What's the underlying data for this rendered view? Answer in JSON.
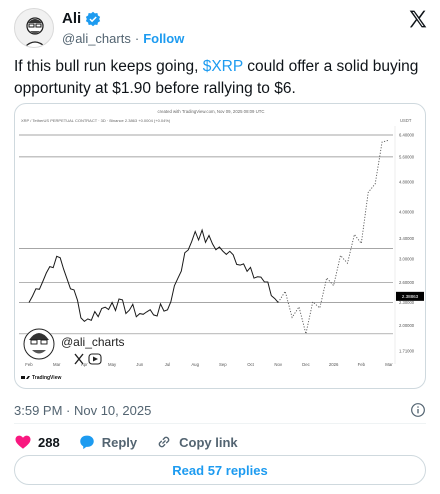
{
  "author": {
    "name": "Ali",
    "handle": "@ali_charts",
    "separator": "·",
    "follow_label": "Follow"
  },
  "tweet": {
    "text_before": "If this bull run keeps going, ",
    "cashtag": "$XRP",
    "text_after": " could offer a solid buying opportunity at $1.90 before rallying to $6."
  },
  "chart": {
    "created_with": "created with TradingView.com, Nov 09, 2025 08:09 UTC",
    "symbol_line": "XRP / TetherUS PERPETUAL CONTRACT · 3D · Binance  2.3863  +0.0004 (+0.04%)",
    "currency": "USDT",
    "watermark_handle": "@ali_charts",
    "brand": "TradingView",
    "price_labels": [
      "6.40000",
      "5.60000",
      "4.80000",
      "4.00000",
      "3.40000",
      "3.00000",
      "2.60000",
      "2.30000",
      "2.00000",
      "1.71000"
    ],
    "current_price": "2.38863",
    "month_labels": [
      "Feb",
      "Mar",
      "Apr",
      "May",
      "Jun",
      "Jul",
      "Aug",
      "Sep",
      "Oct",
      "Nov",
      "Dec",
      "2026",
      "Feb",
      "Mar"
    ],
    "colors": {
      "price": "#1a1a1a",
      "projection": "#555555",
      "level": "#888888",
      "badge": "#000000"
    }
  },
  "chart_data": {
    "type": "line",
    "title": "",
    "xlabel": "",
    "ylabel": "",
    "ylim": [
      1.7,
      6.6
    ],
    "x": [
      "Feb",
      "Mar",
      "Apr",
      "May",
      "Jun",
      "Jul",
      "Aug",
      "Sep",
      "Oct",
      "Nov",
      "Dec",
      "2026",
      "Feb",
      "Mar"
    ],
    "series": [
      {
        "values": [
          2.3,
          3.05,
          2.05,
          2.3,
          2.15,
          2.2,
          3.55,
          3.15,
          2.85,
          2.3
        ]
      },
      {
        "values": [
          null,
          null,
          null,
          null,
          null,
          null,
          null,
          null,
          null,
          2.3,
          1.9,
          2.55,
          3.3,
          6.2
        ]
      }
    ],
    "levels": [
      6.4,
      5.6,
      3.2,
      2.6,
      2.3,
      1.9
    ],
    "grid": false
  },
  "meta": {
    "timestamp": "3:59 PM · Nov 10, 2025"
  },
  "actions": {
    "like_count": "288",
    "reply_label": "Reply",
    "copy_label": "Copy link",
    "read_replies": "Read 57 replies"
  }
}
